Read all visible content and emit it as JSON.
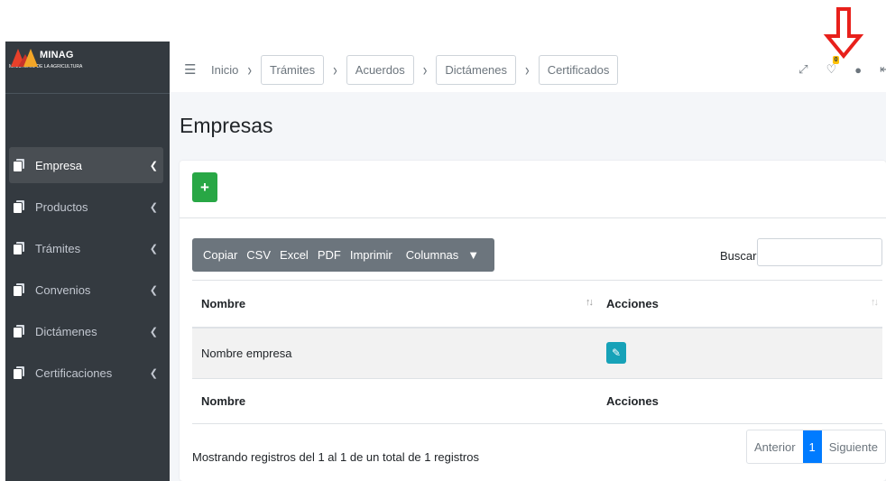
{
  "brand": {
    "name": "MINAG",
    "subtitle": "MINISTERIO DE LA AGRICULTURA"
  },
  "sidebar": {
    "items": [
      {
        "label": "Empresa",
        "active": true
      },
      {
        "label": "Productos"
      },
      {
        "label": "Trámites"
      },
      {
        "label": "Convenios"
      },
      {
        "label": "Dictámenes"
      },
      {
        "label": "Certificaciones"
      }
    ]
  },
  "topbar": {
    "home": "Inicio",
    "breadcrumbs": [
      "Trámites",
      "Acuerdos",
      "Dictámenes",
      "Certificados"
    ],
    "notification_count": "0",
    "icons": [
      "hamburger-icon",
      "fullscreen-icon",
      "bell-icon",
      "user-icon",
      "logout-icon"
    ]
  },
  "page": {
    "title": "Empresas"
  },
  "toolbar": {
    "buttons": [
      "Copiar",
      "CSV",
      "Excel",
      "PDF",
      "Imprimir",
      "Columnas"
    ],
    "search_label": "Buscar:"
  },
  "table": {
    "headers": [
      "Nombre",
      "Acciones"
    ],
    "rows": [
      {
        "nombre": "Nombre empresa"
      }
    ],
    "footer": [
      "Nombre",
      "Acciones"
    ]
  },
  "info": "Mostrando registros del 1 al 1 de un total de 1 registros",
  "pagination": {
    "prev": "Anterior",
    "current": "1",
    "next": "Siguiente"
  },
  "colors": {
    "sidebar": "#343a40",
    "add": "#28a745",
    "edit": "#17a2b8",
    "page_active": "#007bff",
    "arrow": "#e8201b"
  }
}
